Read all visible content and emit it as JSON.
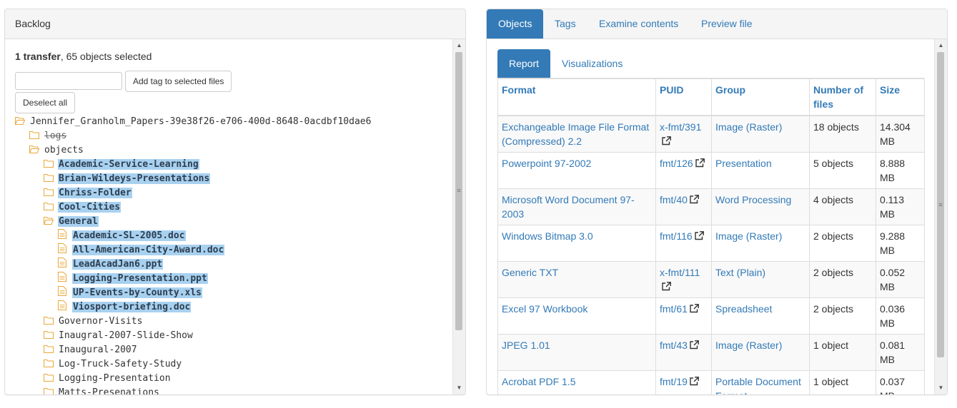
{
  "backlog": {
    "title": "Backlog",
    "selection_count": "1 transfer",
    "selection_rest": ", 65 objects selected",
    "tag_input_placeholder": "",
    "add_tag_label": "Add tag to selected files",
    "deselect_label": "Deselect all",
    "tree": [
      {
        "label": "Jennifer_Granholm_Papers-39e38f26-e706-400d-8648-0acdbf10dae6",
        "icon": "folder-open-icon",
        "depth": 0,
        "selected": false,
        "strike": false
      },
      {
        "label": "logs",
        "icon": "folder-icon",
        "depth": 1,
        "selected": false,
        "strike": true
      },
      {
        "label": "objects",
        "icon": "folder-open-icon",
        "depth": 1,
        "selected": false,
        "strike": false
      },
      {
        "label": "Academic-Service-Learning",
        "icon": "folder-icon",
        "depth": 2,
        "selected": true,
        "strike": false
      },
      {
        "label": "Brian-Wildeys-Presentations",
        "icon": "folder-icon",
        "depth": 2,
        "selected": true,
        "strike": false
      },
      {
        "label": "Chriss-Folder",
        "icon": "folder-icon",
        "depth": 2,
        "selected": true,
        "strike": false
      },
      {
        "label": "Cool-Cities",
        "icon": "folder-icon",
        "depth": 2,
        "selected": true,
        "strike": false
      },
      {
        "label": "General",
        "icon": "folder-open-icon",
        "depth": 2,
        "selected": true,
        "strike": false
      },
      {
        "label": "Academic-SL-2005.doc",
        "icon": "file-icon",
        "depth": 3,
        "selected": true,
        "strike": false
      },
      {
        "label": "All-American-City-Award.doc",
        "icon": "file-icon",
        "depth": 3,
        "selected": true,
        "strike": false
      },
      {
        "label": "LeadAcadJan6.ppt",
        "icon": "file-icon",
        "depth": 3,
        "selected": true,
        "strike": false
      },
      {
        "label": "Logging-Presentation.ppt",
        "icon": "file-icon",
        "depth": 3,
        "selected": true,
        "strike": false
      },
      {
        "label": "UP-Events-by-County.xls",
        "icon": "file-icon",
        "depth": 3,
        "selected": true,
        "strike": false
      },
      {
        "label": "Viosport-briefing.doc",
        "icon": "file-icon",
        "depth": 3,
        "selected": true,
        "strike": false
      },
      {
        "label": "Governor-Visits",
        "icon": "folder-icon",
        "depth": 2,
        "selected": false,
        "strike": false
      },
      {
        "label": "Inaugral-2007-Slide-Show",
        "icon": "folder-icon",
        "depth": 2,
        "selected": false,
        "strike": false
      },
      {
        "label": "Inaugural-2007",
        "icon": "folder-icon",
        "depth": 2,
        "selected": false,
        "strike": false
      },
      {
        "label": "Log-Truck-Safety-Study",
        "icon": "folder-icon",
        "depth": 2,
        "selected": false,
        "strike": false
      },
      {
        "label": "Logging-Presentation",
        "icon": "folder-icon",
        "depth": 2,
        "selected": false,
        "strike": false
      },
      {
        "label": "Matts-Presenations",
        "icon": "folder-icon",
        "depth": 2,
        "selected": false,
        "strike": false
      }
    ]
  },
  "analysis": {
    "tabs": [
      "Objects",
      "Tags",
      "Examine contents",
      "Preview file"
    ],
    "active_tab": "Objects",
    "subtabs": [
      "Report",
      "Visualizations"
    ],
    "active_subtab": "Report",
    "table": {
      "headers": [
        "Format",
        "PUID",
        "Group",
        "Number of files",
        "Size"
      ],
      "rows": [
        {
          "format": "Exchangeable Image File Format (Compressed) 2.2",
          "puid": "x-fmt/391",
          "group": "Image (Raster)",
          "count": "18 objects",
          "size": "14.304 MB"
        },
        {
          "format": "Powerpoint 97-2002",
          "puid": "fmt/126",
          "group": "Presentation",
          "count": "5 objects",
          "size": "8.888 MB"
        },
        {
          "format": "Microsoft Word Document 97-2003",
          "puid": "fmt/40",
          "group": "Word Processing",
          "count": "4 objects",
          "size": "0.113 MB"
        },
        {
          "format": "Windows Bitmap 3.0",
          "puid": "fmt/116",
          "group": "Image (Raster)",
          "count": "2 objects",
          "size": "9.288 MB"
        },
        {
          "format": "Generic TXT",
          "puid": "x-fmt/111",
          "group": "Text (Plain)",
          "count": "2 objects",
          "size": "0.052 MB"
        },
        {
          "format": "Excel 97 Workbook",
          "puid": "fmt/61",
          "group": "Spreadsheet",
          "count": "2 objects",
          "size": "0.036 MB"
        },
        {
          "format": "JPEG 1.01",
          "puid": "fmt/43",
          "group": "Image (Raster)",
          "count": "1 object",
          "size": "0.081 MB"
        },
        {
          "format": "Acrobat PDF 1.5",
          "puid": "fmt/19",
          "group": "Portable Document Format",
          "count": "1 object",
          "size": "0.037 MB"
        }
      ]
    }
  },
  "colors": {
    "link": "#337ab7",
    "selected_bg": "#a8d1f0",
    "folder": "#e8a93b"
  }
}
